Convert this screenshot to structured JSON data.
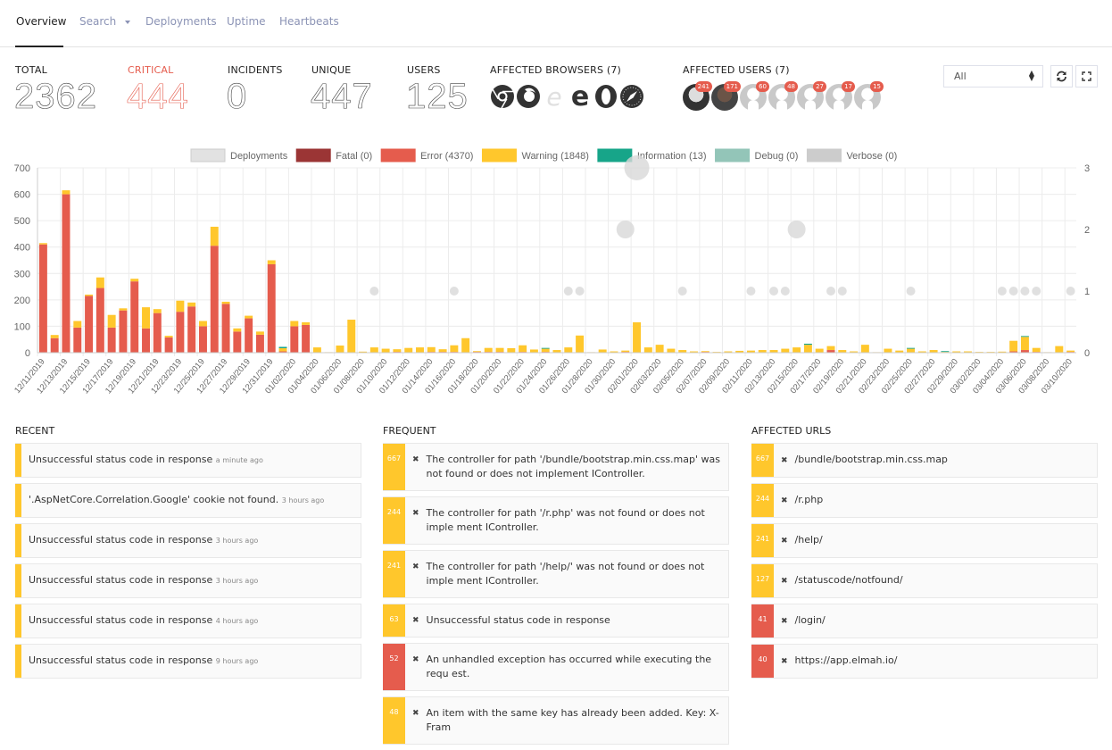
{
  "tabs": [
    {
      "label": "Overview",
      "active": true
    },
    {
      "label": "Search",
      "dropdown": true
    },
    {
      "label": "Deployments"
    },
    {
      "label": "Uptime"
    },
    {
      "label": "Heartbeats"
    }
  ],
  "stats": {
    "total": {
      "label": "TOTAL",
      "value": "2362"
    },
    "critical": {
      "label": "CRITICAL",
      "value": "444"
    },
    "incidents": {
      "label": "INCIDENTS",
      "value": "0"
    },
    "unique": {
      "label": "UNIQUE",
      "value": "447"
    },
    "users": {
      "label": "USERS",
      "value": "125"
    }
  },
  "affected_browsers": {
    "label": "AFFECTED BROWSERS (7)",
    "icons": [
      "chrome-icon",
      "firefox-icon",
      "internet-explorer-icon",
      "edge-icon",
      "opera-icon",
      "safari-icon"
    ]
  },
  "affected_users": {
    "label": "AFFECTED USERS (7)",
    "counts": [
      "241",
      "171",
      "60",
      "48",
      "27",
      "17",
      "15"
    ]
  },
  "filter": {
    "selected": "All"
  },
  "colors": {
    "fatal": "#9b3535",
    "error": "#e55c4d",
    "warning": "#ffc72c",
    "information": "#17a589",
    "debug": "#93c5b8",
    "verbose": "#cccccc",
    "deployments": "#e2e2e2"
  },
  "chart_data": {
    "type": "bar",
    "stacked": true,
    "legend": [
      {
        "name": "Deployments",
        "key": "deployments"
      },
      {
        "name": "Fatal (0)",
        "key": "fatal"
      },
      {
        "name": "Error (4370)",
        "key": "error"
      },
      {
        "name": "Warning (1848)",
        "key": "warning"
      },
      {
        "name": "Information (13)",
        "key": "information"
      },
      {
        "name": "Debug (0)",
        "key": "debug"
      },
      {
        "name": "Verbose (0)",
        "key": "verbose"
      }
    ],
    "legend_position": "top",
    "ylim": [
      0,
      700
    ],
    "yticks": [
      0,
      100,
      200,
      300,
      400,
      500,
      600,
      700
    ],
    "y2lim": [
      0,
      3
    ],
    "y2ticks": [
      0,
      1,
      2,
      3
    ],
    "grid": true,
    "start_date": "2019-12-11",
    "days": 91,
    "xtick_labels": [
      "12/11/2019",
      "12/13/2019",
      "12/15/2019",
      "12/17/2019",
      "12/19/2019",
      "12/21/2019",
      "12/23/2019",
      "12/25/2019",
      "12/27/2019",
      "12/29/2019",
      "12/31/2019",
      "01/02/2020",
      "01/04/2020",
      "01/06/2020",
      "01/08/2020",
      "01/10/2020",
      "01/12/2020",
      "01/14/2020",
      "01/16/2020",
      "01/18/2020",
      "01/20/2020",
      "01/22/2020",
      "01/24/2020",
      "01/26/2020",
      "01/28/2020",
      "01/30/2020",
      "02/01/2020",
      "02/03/2020",
      "02/05/2020",
      "02/07/2020",
      "02/09/2020",
      "02/11/2020",
      "02/13/2020",
      "02/15/2020",
      "02/17/2020",
      "02/19/2020",
      "02/21/2020",
      "02/23/2020",
      "02/25/2020",
      "02/27/2020",
      "02/29/2020",
      "03/02/2020",
      "03/04/2020",
      "03/06/2020",
      "03/08/2020",
      "03/10/2020"
    ],
    "series": [
      {
        "name": "Error",
        "key": "error",
        "values": [
          410,
          55,
          600,
          95,
          215,
          245,
          95,
          160,
          270,
          92,
          150,
          58,
          155,
          175,
          100,
          405,
          185,
          80,
          130,
          68,
          335,
          5,
          100,
          105,
          0,
          0,
          0,
          0,
          0,
          0,
          0,
          3,
          0,
          0,
          3,
          3,
          3,
          0,
          3,
          3,
          3,
          0,
          3,
          0,
          3,
          0,
          0,
          0,
          0,
          0,
          0,
          3,
          0,
          0,
          0,
          0,
          0,
          0,
          3,
          0,
          0,
          0,
          0,
          0,
          0,
          0,
          0,
          0,
          0,
          10,
          0,
          0,
          0,
          0,
          0,
          0,
          0,
          0,
          0,
          0,
          0,
          0,
          0,
          0,
          0,
          5,
          10,
          3,
          0,
          0,
          3
        ]
      },
      {
        "name": "Warning",
        "key": "warning",
        "values": [
          5,
          12,
          15,
          25,
          5,
          40,
          48,
          8,
          10,
          80,
          15,
          6,
          42,
          15,
          20,
          72,
          8,
          12,
          10,
          12,
          15,
          12,
          20,
          10,
          20,
          2,
          27,
          125,
          4,
          20,
          15,
          10,
          18,
          20,
          18,
          10,
          25,
          55,
          3,
          15,
          15,
          17,
          25,
          12,
          12,
          10,
          20,
          65,
          2,
          12,
          5,
          5,
          115,
          20,
          30,
          15,
          10,
          5,
          3,
          3,
          5,
          7,
          8,
          10,
          10,
          15,
          20,
          30,
          15,
          15,
          10,
          5,
          30,
          2,
          15,
          8,
          15,
          5,
          10,
          3,
          5,
          5,
          3,
          3,
          4,
          40,
          50,
          15,
          2,
          25,
          5
        ]
      },
      {
        "name": "Information",
        "key": "information",
        "values": [
          0,
          0,
          0,
          0,
          0,
          0,
          0,
          0,
          0,
          0,
          0,
          0,
          0,
          0,
          0,
          0,
          0,
          0,
          0,
          0,
          0,
          5,
          0,
          0,
          0,
          0,
          0,
          0,
          0,
          0,
          0,
          0,
          0,
          0,
          0,
          0,
          0,
          0,
          0,
          0,
          0,
          0,
          0,
          0,
          3,
          0,
          0,
          0,
          0,
          0,
          0,
          0,
          0,
          0,
          0,
          0,
          0,
          0,
          0,
          0,
          0,
          0,
          0,
          0,
          0,
          0,
          0,
          4,
          0,
          0,
          0,
          0,
          0,
          0,
          0,
          0,
          3,
          0,
          0,
          3,
          0,
          0,
          0,
          0,
          0,
          0,
          3,
          0,
          0,
          0,
          0
        ]
      }
    ],
    "deployments": [
      {
        "day": 30,
        "count": 1
      },
      {
        "day": 37,
        "count": 1
      },
      {
        "day": 47,
        "count": 1
      },
      {
        "day": 48,
        "count": 1
      },
      {
        "day": 52,
        "count": 2
      },
      {
        "day": 53,
        "count": 3
      },
      {
        "day": 57,
        "count": 1
      },
      {
        "day": 63,
        "count": 1
      },
      {
        "day": 65,
        "count": 1
      },
      {
        "day": 66,
        "count": 1
      },
      {
        "day": 67,
        "count": 2
      },
      {
        "day": 70,
        "count": 1
      },
      {
        "day": 71,
        "count": 1
      },
      {
        "day": 77,
        "count": 1
      },
      {
        "day": 85,
        "count": 1
      },
      {
        "day": 86,
        "count": 1
      },
      {
        "day": 87,
        "count": 1
      },
      {
        "day": 88,
        "count": 1
      },
      {
        "day": 91,
        "count": 1
      }
    ]
  },
  "recent": {
    "title": "RECENT",
    "items": [
      {
        "message": "Unsuccessful status code in response",
        "ago": "a minute ago"
      },
      {
        "message": "'.AspNetCore.Correlation.Google' cookie not found.",
        "ago": "3 hours ago"
      },
      {
        "message": "Unsuccessful status code in response",
        "ago": "3 hours ago"
      },
      {
        "message": "Unsuccessful status code in response",
        "ago": "3 hours ago"
      },
      {
        "message": "Unsuccessful status code in response",
        "ago": "4 hours ago"
      },
      {
        "message": "Unsuccessful status code in response",
        "ago": "9 hours ago"
      }
    ]
  },
  "frequent": {
    "title": "FREQUENT",
    "items": [
      {
        "count": "667",
        "level": "warn",
        "message": "The controller for path '/bundle/bootstrap.min.css.map' was not found or does not implement IController."
      },
      {
        "count": "244",
        "level": "warn",
        "message": "The controller for path '/r.php' was not found or does not imple ment IController."
      },
      {
        "count": "241",
        "level": "warn",
        "message": "The controller for path '/help/' was not found or does not imple ment IController."
      },
      {
        "count": "63",
        "level": "warn",
        "message": "Unsuccessful status code in response"
      },
      {
        "count": "52",
        "level": "err",
        "message": "An unhandled exception has occurred while executing the requ est."
      },
      {
        "count": "48",
        "level": "warn",
        "message": "An item with the same key has already been added. Key: X-Fram"
      }
    ]
  },
  "affected_urls": {
    "title": "AFFECTED URLS",
    "items": [
      {
        "count": "667",
        "level": "warn",
        "url": "/bundle/bootstrap.min.css.map"
      },
      {
        "count": "244",
        "level": "warn",
        "url": "/r.php"
      },
      {
        "count": "241",
        "level": "warn",
        "url": "/help/"
      },
      {
        "count": "127",
        "level": "warn",
        "url": "/statuscode/notfound/"
      },
      {
        "count": "41",
        "level": "err",
        "url": "/login/"
      },
      {
        "count": "40",
        "level": "err",
        "url": "https://app.elmah.io/"
      }
    ]
  }
}
